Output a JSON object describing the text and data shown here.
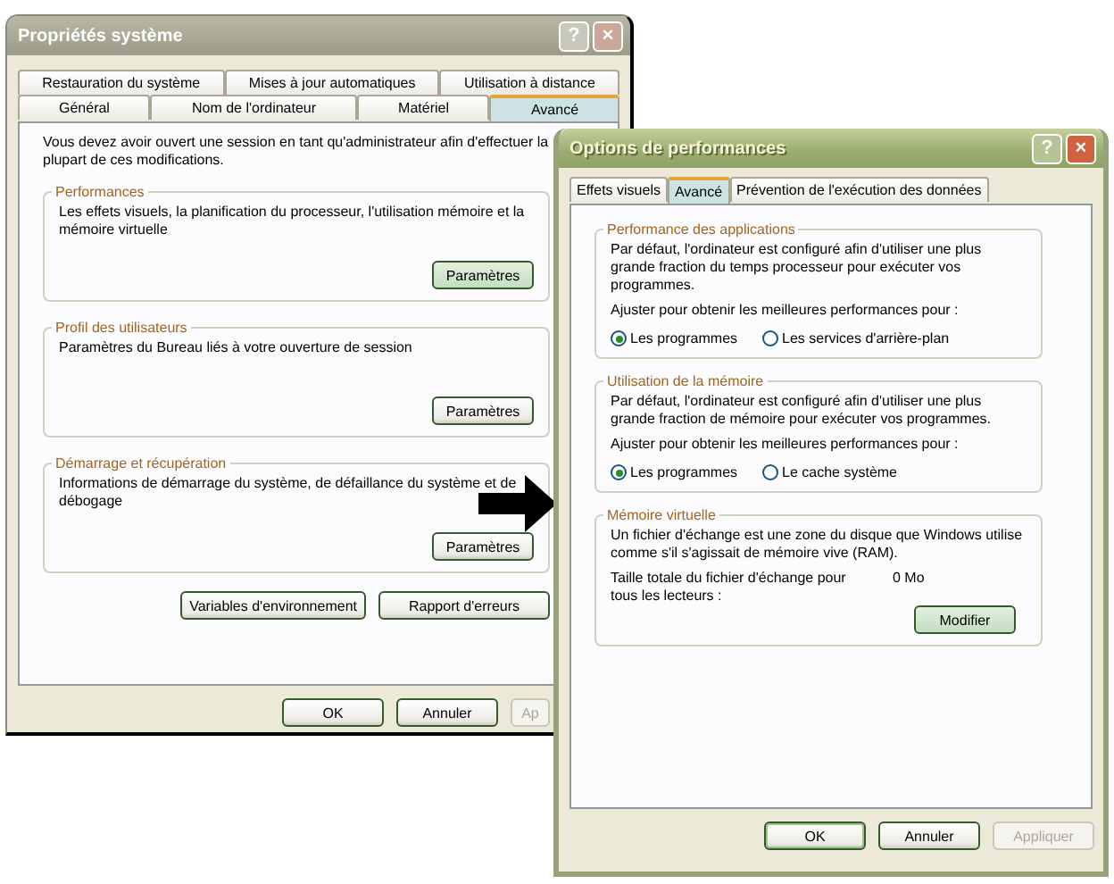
{
  "windows": [
    {
      "kind": "system",
      "active": false,
      "title": "Propriétés système",
      "help": "?",
      "close": "×",
      "tab_rows": [
        [
          {
            "label": "Restauration du système",
            "selected": false
          },
          {
            "label": "Mises à jour automatiques",
            "selected": false
          },
          {
            "label": "Utilisation à distance",
            "selected": false
          }
        ],
        [
          {
            "label": "Général",
            "selected": false
          },
          {
            "label": "Nom de l'ordinateur",
            "selected": false
          },
          {
            "label": "Matériel",
            "selected": false
          },
          {
            "label": "Avancé",
            "selected": true
          }
        ]
      ],
      "intro": "Vous devez avoir ouvert une session en tant qu'administrateur afin d'effectuer la plupart de ces modifications.",
      "groups": [
        {
          "kind": "settings",
          "title": "Performances",
          "text": "Les effets visuels, la planification du processeur, l'utilisation mémoire et la mémoire virtuelle",
          "button": {
            "label": "Paramètres",
            "highlighted": true
          }
        },
        {
          "kind": "settings",
          "title": "Profil des utilisateurs",
          "text": "Paramètres du Bureau liés à votre ouverture de session",
          "button": {
            "label": "Paramètres",
            "highlighted": false
          }
        },
        {
          "kind": "settings",
          "title": "Démarrage et récupération",
          "text": "Informations de démarrage du système, de défaillance du système et de débogage",
          "button": {
            "label": "Paramètres",
            "highlighted": false
          }
        }
      ],
      "extra_buttons": [
        {
          "label": "Variables d'environnement",
          "highlighted": false
        },
        {
          "label": "Rapport d'erreurs",
          "highlighted": false
        }
      ],
      "footer": [
        {
          "label": "OK",
          "default": false,
          "disabled": false
        },
        {
          "label": "Annuler",
          "default": false,
          "disabled": false
        },
        {
          "label": "Ap",
          "default": false,
          "disabled": true
        }
      ]
    },
    {
      "kind": "performance",
      "active": true,
      "title": "Options de performances",
      "help": "?",
      "close": "×",
      "tab_rows": [
        [
          {
            "label": "Effets visuels",
            "selected": false
          },
          {
            "label": "Avancé",
            "selected": true
          },
          {
            "label": "Prévention de l'exécution des données",
            "selected": false
          }
        ]
      ],
      "groups": [
        {
          "kind": "options",
          "title": "Performance des applications",
          "text": "Par défaut, l'ordinateur est configuré afin d'utiliser une plus grande fraction du temps processeur pour exécuter vos programmes.",
          "prompt": "Ajuster pour obtenir les meilleures performances pour :",
          "radios": [
            {
              "label": "Les programmes",
              "selected": true
            },
            {
              "label": "Les services d'arrière-plan",
              "selected": false
            }
          ]
        },
        {
          "kind": "options",
          "title": "Utilisation de la mémoire",
          "text": "Par défaut, l'ordinateur est configuré afin d'utiliser une plus grande fraction de mémoire pour exécuter vos programmes.",
          "prompt": "Ajuster pour obtenir les meilleures performances pour :",
          "radios": [
            {
              "label": "Les programmes",
              "selected": true
            },
            {
              "label": "Le cache système",
              "selected": false
            }
          ]
        },
        {
          "kind": "paging",
          "title": "Mémoire virtuelle",
          "text": "Un fichier d'échange est une zone du disque que Windows utilise comme s'il s'agissait de mémoire vive (RAM).",
          "size_label": "Taille totale du fichier d'échange pour tous les lecteurs :",
          "size_value": "0 Mo",
          "button": {
            "label": "Modifier",
            "highlighted": true
          }
        }
      ],
      "footer": [
        {
          "label": "OK",
          "default": true,
          "disabled": false
        },
        {
          "label": "Annuler",
          "default": false,
          "disabled": false
        },
        {
          "label": "Appliquer",
          "default": false,
          "disabled": true
        }
      ]
    }
  ]
}
